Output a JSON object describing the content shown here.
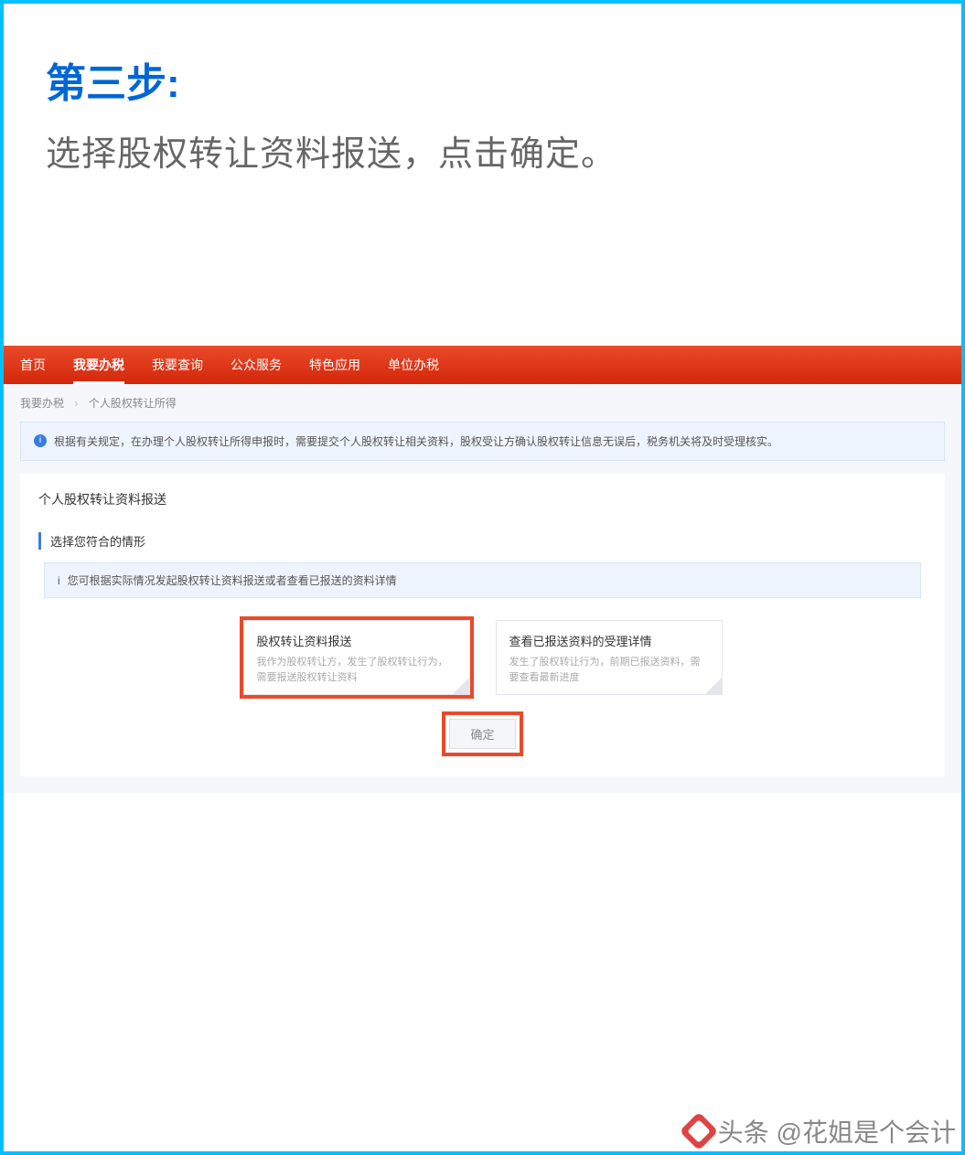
{
  "step": {
    "title": "第三步:",
    "desc": "选择股权转让资料报送，点击确定。"
  },
  "nav": {
    "items": [
      "首页",
      "我要办税",
      "我要查询",
      "公众服务",
      "特色应用",
      "单位办税"
    ],
    "activeIndex": 1
  },
  "breadcrumb": {
    "a": "我要办税",
    "b": "个人股权转让所得"
  },
  "alerts": {
    "top": "根据有关规定，在办理个人股权转让所得申报时，需要提交个人股权转让相关资料，股权受让方确认股权转让信息无误后，税务机关将及时受理核实。",
    "inner": "您可根据实际情况发起股权转让资料报送或者查看已报送的资料详情"
  },
  "panel": {
    "title": "个人股权转让资料报送",
    "sectionLabel": "选择您符合的情形"
  },
  "cards": [
    {
      "title": "股权转让资料报送",
      "desc": "我作为股权转让方，发生了股权转让行为，需要报送股权转让资料",
      "selected": true
    },
    {
      "title": "查看已报送资料的受理详情",
      "desc": "发生了股权转让行为，前期已报送资料，需要查看最新进度",
      "selected": false
    }
  ],
  "buttons": {
    "confirm": "确定"
  },
  "watermark": "头条 @花姐是个会计"
}
